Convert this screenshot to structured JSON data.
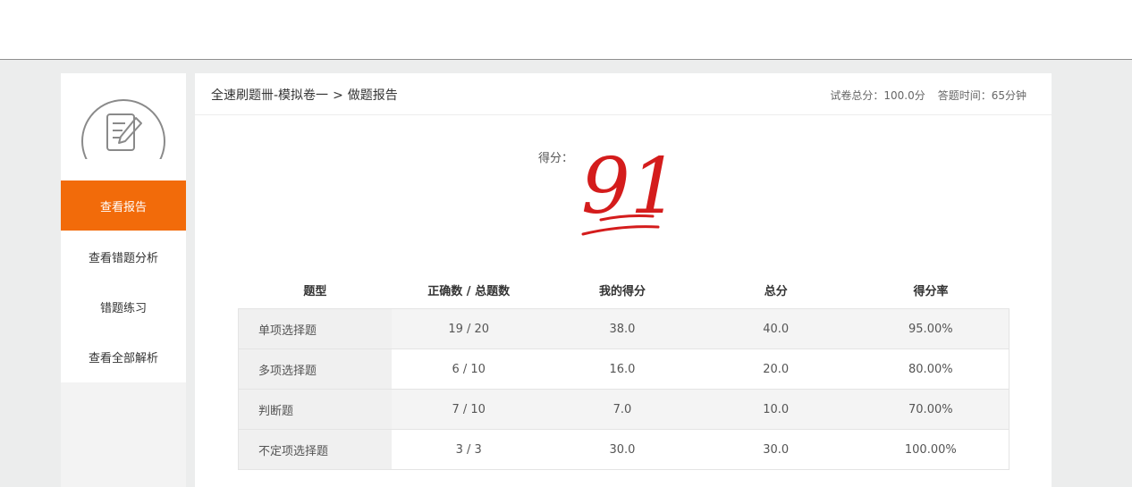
{
  "colors": {
    "accent": "#f26b0a",
    "score_ink": "#d41c1c",
    "stage_bg": "#eceded"
  },
  "sidebar": {
    "logo_icon": "exam-paper-pencil-icon",
    "items": [
      {
        "label": "查看报告",
        "active": true
      },
      {
        "label": "查看错题分析",
        "active": false
      },
      {
        "label": "错题练习",
        "active": false
      },
      {
        "label": "查看全部解析",
        "active": false
      }
    ]
  },
  "header": {
    "breadcrumb_parent": "全速刷题卌-模拟卷一",
    "breadcrumb_sep": ">",
    "breadcrumb_current": "做题报告",
    "total_score": "试卷总分：100.0分",
    "time_used": "答题时间：65分钟"
  },
  "score": {
    "label": "得分：",
    "value": "91"
  },
  "table": {
    "headers": [
      "题型",
      "正确数 / 总题数",
      "我的得分",
      "总分",
      "得分率"
    ],
    "rows": [
      [
        "单项选择题",
        "19 / 20",
        "38.0",
        "40.0",
        "95.00%"
      ],
      [
        "多项选择题",
        "6 / 10",
        "16.0",
        "20.0",
        "80.00%"
      ],
      [
        "判断题",
        "7 / 10",
        "7.0",
        "10.0",
        "70.00%"
      ],
      [
        "不定项选择题",
        "3 / 3",
        "30.0",
        "30.0",
        "100.00%"
      ]
    ]
  }
}
